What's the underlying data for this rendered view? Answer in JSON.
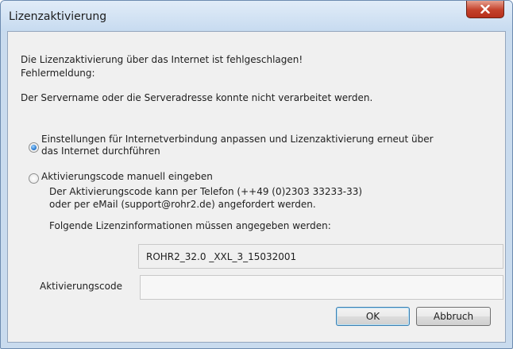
{
  "window": {
    "title": "Lizenzaktivierung",
    "close_icon": "close-icon"
  },
  "message": {
    "line1": "Die Lizenzaktivierung über das Internet ist fehlgeschlagen!",
    "line2": "Fehlermeldung:",
    "error_text": "Der Servername oder die Serveradresse konnte nicht verarbeitet werden."
  },
  "options": {
    "internet": {
      "label_line1": "Einstellungen für Internetverbindung anpassen und Lizenzaktivierung erneut über",
      "label_line2": "das Internet durchführen",
      "checked": true
    },
    "manual": {
      "label": "Aktivierungscode manuell eingeben",
      "checked": false,
      "info_line1": "Der Aktivierungscode kann per Telefon (++49 (0)2303 33233-33)",
      "info_line2": "oder per eMail  (support@rohr2.de) angefordert werden.",
      "info_line3": "Folgende Lizenzinformationen müssen angegeben werden:"
    }
  },
  "license_info": "ROHR2_32.0 _XXL_3_15032001",
  "activation_code": {
    "label": "Aktivierungscode",
    "value": ""
  },
  "buttons": {
    "ok": "OK",
    "cancel": "Abbruch"
  },
  "colors": {
    "title_bar": "#c7dbf0",
    "close_button": "#c4412b",
    "dialog_bg": "#f0f0f0"
  }
}
